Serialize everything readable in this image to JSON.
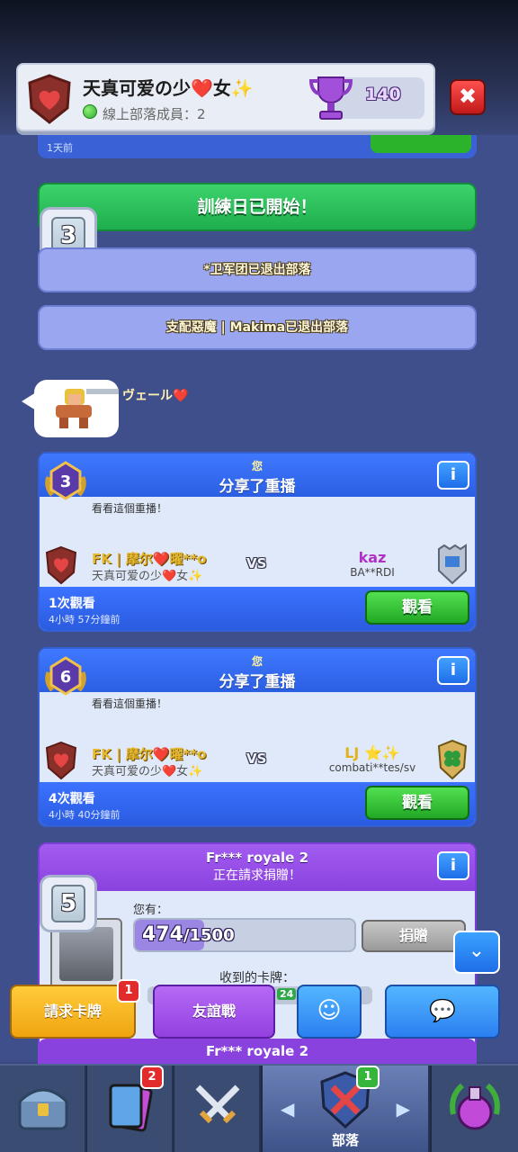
{
  "header": {
    "clan_name": "天真可爱の少❤️女✨",
    "online_label": "線上部落成員：2",
    "trophies": "140",
    "close_symbol": "✖"
  },
  "feed": {
    "top_ago": "1天前",
    "training_banner": "訓練日已開始！",
    "training_level": "3",
    "left1": "*卫军团已退出部落",
    "left2": "支配惡魔 | Makima已退出部落",
    "chat_user": "ヴェール❤️"
  },
  "replays": [
    {
      "level": "3",
      "you": "您",
      "shared": "分享了重播",
      "prompt": "看看這個重播！",
      "p1_name": "FK | 摩尔❤️曜**o",
      "p1_clan": "天真可爱の少❤️女✨",
      "vs": "VS",
      "p2_name": "kaz",
      "p2_name_color": "#b030c8",
      "p2_clan": "BA**RDI",
      "views": "1次觀看",
      "time": "4小時 57分鐘前",
      "watch": "觀看",
      "info": "i"
    },
    {
      "level": "6",
      "you": "您",
      "shared": "分享了重播",
      "prompt": "看看這個重播！",
      "p1_name": "FK | 摩尔❤️曜**o",
      "p1_clan": "天真可爱の少❤️女✨",
      "vs": "VS",
      "p2_name": "LJ ⭐✨",
      "p2_name_color": "#e2b21e",
      "p2_clan": "combati**tes/sv",
      "views": "4次觀看",
      "time": "4小時 40分鐘前",
      "watch": "觀看",
      "info": "i"
    }
  ],
  "donation": {
    "title": "Fr*** royale 2",
    "subtitle": "正在請求捐贈！",
    "level": "5",
    "you_have": "您有：",
    "have": "474",
    "need": "/1500",
    "progress_fraction": 0.316,
    "donate": "捐贈",
    "received": "收到的卡牌：",
    "received_count": "24",
    "info": "i"
  },
  "next_card_title": "Fr*** royale 2",
  "actions": {
    "request": "請求卡牌",
    "request_badge": "1",
    "friendly": "友誼戰",
    "emote_icon": "☺",
    "chat_icon": "💬",
    "scroll_icon": "⌄"
  },
  "nav": {
    "cards_badge": "2",
    "clan_badge": "1",
    "clan_label": "部落",
    "left_arrow": "◀",
    "right_arrow": "▶"
  },
  "colors": {
    "feed_bg": "#3f4f8c",
    "green_banner": "#2fc45d",
    "lilac_banner": "#9aa6ef",
    "replay_blue": "#2b5fe3",
    "donation_purple": "#8a42df"
  }
}
